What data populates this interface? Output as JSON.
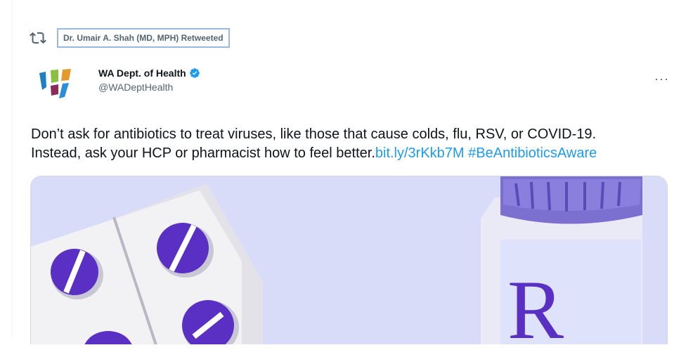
{
  "retweet": {
    "label": "Dr. Umair A. Shah (MD, MPH) Retweeted",
    "icon": "retweet-icon"
  },
  "author": {
    "display_name": "WA Dept. of Health",
    "handle": "@WADeptHealth",
    "verified": true,
    "avatar_icon": "wa-doh-logo"
  },
  "more_label": "···",
  "tweet": {
    "text_line1": "Don’t ask for antibiotics to treat viruses, like those that cause colds, flu, RSV, or COVID-19.",
    "text_line2": "Instead, ask your HCP or pharmacist how to feel better.",
    "link": "bit.ly/3rKkb7M",
    "hashtag": "#BeAntibioticsAware"
  },
  "media": {
    "rx_symbol": "R",
    "colors": {
      "background": "#d8dcf8",
      "pill": "#5a2fc4",
      "link": "#1d9bf0"
    }
  }
}
